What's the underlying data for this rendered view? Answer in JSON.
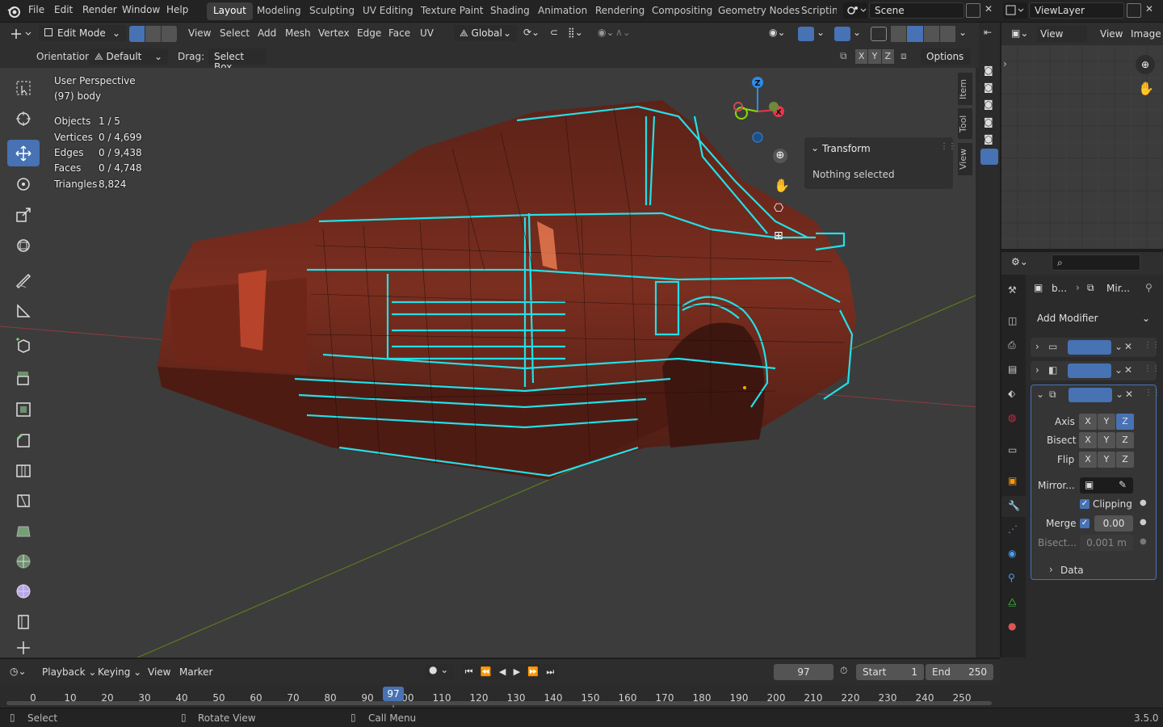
{
  "topbar": {
    "menus": [
      "File",
      "Edit",
      "Render",
      "Window",
      "Help"
    ],
    "workspaces": [
      "Layout",
      "Modeling",
      "Sculpting",
      "UV Editing",
      "Texture Paint",
      "Shading",
      "Animation",
      "Rendering",
      "Compositing",
      "Geometry Nodes",
      "Scripting"
    ],
    "active_workspace": "Layout",
    "scene": "Scene",
    "view_layer": "ViewLayer"
  },
  "viewport_header": {
    "mode": "Edit Mode",
    "menus": [
      "View",
      "Select",
      "Add",
      "Mesh",
      "Vertex",
      "Edge",
      "Face",
      "UV"
    ],
    "transform_orientation": "Global",
    "orientation_label": "Orientation:",
    "orientation_value": "Default",
    "drag_label": "Drag:",
    "drag_value": "Select Box",
    "axes": [
      "X",
      "Y",
      "Z"
    ],
    "options_label": "Options"
  },
  "viewport_overlay": {
    "view_name": "User Perspective",
    "object_name": "(97) body",
    "stats": [
      {
        "label": "Objects",
        "value": "1 / 5"
      },
      {
        "label": "Vertices",
        "value": "0 / 4,699"
      },
      {
        "label": "Edges",
        "value": "0 / 9,438"
      },
      {
        "label": "Faces",
        "value": "0 / 4,748"
      },
      {
        "label": "Triangles",
        "value": "8,824"
      }
    ]
  },
  "npanel": {
    "section_title": "Transform",
    "message": "Nothing selected",
    "tabs": [
      "Item",
      "Tool",
      "View"
    ]
  },
  "gizmo": {
    "x": "X",
    "y": "Y",
    "z": "Z"
  },
  "uv_editor": {
    "menus": [
      "View",
      "Image"
    ],
    "view_label": "View"
  },
  "properties": {
    "breadcrumb_object": "b...",
    "breadcrumb_modifier": "Mir...",
    "add_modifier": "Add Modifier",
    "mirror": {
      "axis_label": "Axis",
      "bisect_label": "Bisect",
      "flip_label": "Flip",
      "axis_z_on": true,
      "mirror_object_label": "Mirror...",
      "clipping_label": "Clipping",
      "clipping": true,
      "merge_label": "Merge",
      "merge_value": "0.00",
      "bisect_distance_label": "Bisect...",
      "bisect_distance_value": "0.001 m",
      "data_label": "Data"
    }
  },
  "timeline": {
    "menus": [
      "Playback",
      "Keying",
      "View",
      "Marker"
    ],
    "current_frame": "97",
    "start_label": "Start",
    "start_value": "1",
    "end_label": "End",
    "end_value": "250",
    "ticks": [
      "0",
      "10",
      "20",
      "30",
      "40",
      "50",
      "60",
      "70",
      "80",
      "90",
      "100",
      "110",
      "120",
      "130",
      "140",
      "150",
      "160",
      "170",
      "180",
      "190",
      "200",
      "210",
      "220",
      "230",
      "240",
      "250"
    ]
  },
  "statusbar": {
    "select": "Select",
    "rotate": "Rotate View",
    "call_menu": "Call Menu",
    "version": "3.5.0"
  },
  "colors": {
    "accent": "#4772b3",
    "edge_highlight": "#22e0e8",
    "mesh_body": "#7a2a1c",
    "x_axis": "#e8364f",
    "y_axis": "#8bdc00",
    "z_axis": "#2d8ceb"
  }
}
